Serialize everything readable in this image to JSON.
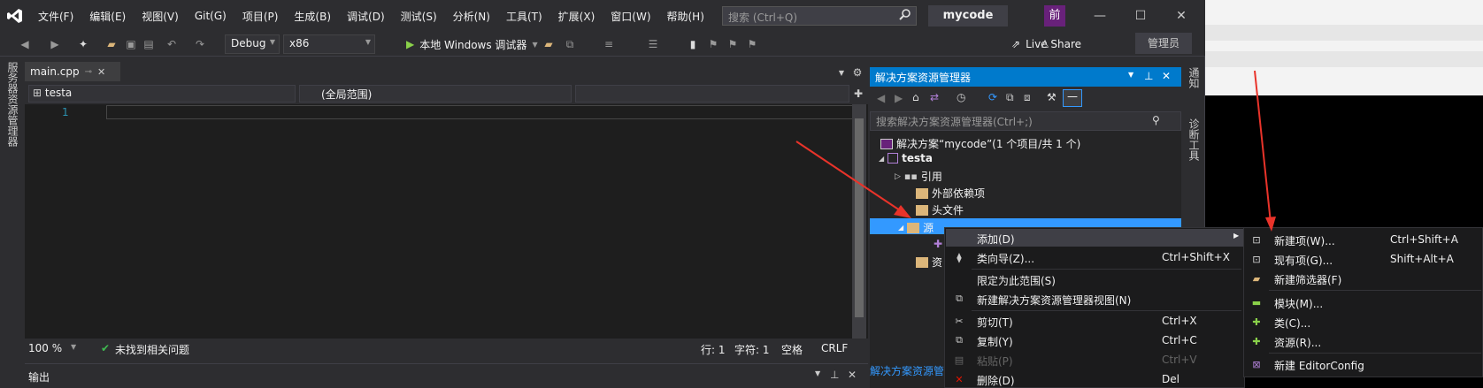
{
  "menubar": [
    "文件(F)",
    "编辑(E)",
    "视图(V)",
    "Git(G)",
    "项目(P)",
    "生成(B)",
    "调试(D)",
    "测试(S)",
    "分析(N)",
    "工具(T)",
    "扩展(X)",
    "窗口(W)",
    "帮助(H)"
  ],
  "search_placeholder": "搜索 (Ctrl+Q)",
  "solution_name": "mycode",
  "avatar": "前",
  "toolbar": {
    "config": "Debug",
    "platform": "x86",
    "run_label": "本地 Windows 调试器",
    "live_share": "Live Share",
    "admin": "管理员"
  },
  "left_tabs": [
    "服务器资源管理器"
  ],
  "editor": {
    "tab": "main.cpp",
    "nav_project": "testa",
    "nav_scope": "(全局范围)",
    "line": "1",
    "zoom": "100 %",
    "status": "未找到相关问题",
    "row": "行: 1",
    "col": "字符: 1",
    "space": "空格",
    "eol": "CRLF"
  },
  "output_title": "输出",
  "solution_explorer": {
    "title": "解决方案资源管理器",
    "search_placeholder": "搜索解决方案资源管理器(Ctrl+;)",
    "solution_label": "解决方案“mycode”(1 个项目/共 1 个)",
    "project": "testa",
    "items": [
      "引用",
      "外部依赖项",
      "头文件",
      "源",
      "资"
    ],
    "footer": "解决方案资源管理器"
  },
  "right_tabs": [
    "通知",
    "诊断工具"
  ],
  "context_menu": [
    {
      "label": "添加(D)",
      "shortcut": "",
      "submenu": true
    },
    {
      "label": "类向导(Z)...",
      "shortcut": "Ctrl+Shift+X"
    },
    {
      "label": "限定为此范围(S)",
      "shortcut": ""
    },
    {
      "label": "新建解决方案资源管理器视图(N)",
      "shortcut": ""
    },
    {
      "label": "剪切(T)",
      "shortcut": "Ctrl+X"
    },
    {
      "label": "复制(Y)",
      "shortcut": "Ctrl+C"
    },
    {
      "label": "粘贴(P)",
      "shortcut": "Ctrl+V",
      "disabled": true
    },
    {
      "label": "删除(D)",
      "shortcut": "Del"
    }
  ],
  "add_submenu": [
    {
      "label": "新建项(W)...",
      "shortcut": "Ctrl+Shift+A"
    },
    {
      "label": "现有项(G)...",
      "shortcut": "Shift+Alt+A"
    },
    {
      "label": "新建筛选器(F)",
      "shortcut": ""
    },
    {
      "label": "模块(M)...",
      "shortcut": ""
    },
    {
      "label": "类(C)...",
      "shortcut": ""
    },
    {
      "label": "资源(R)...",
      "shortcut": ""
    },
    {
      "label": "新建 EditorConfig",
      "shortcut": ""
    }
  ],
  "colors": {
    "accent": "#007acc",
    "selection": "#3399ff",
    "arrow": "#e8332a",
    "vs_purple": "#68217a"
  }
}
